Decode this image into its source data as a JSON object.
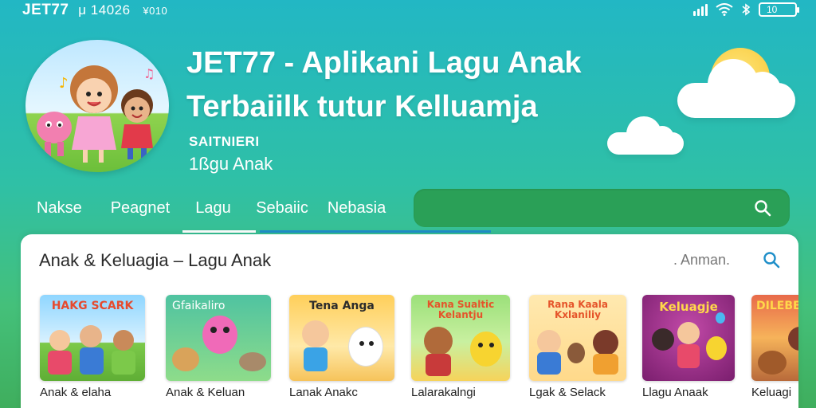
{
  "status_bar": {
    "carrier": "JET77",
    "time": "μ 14026",
    "extra": "¥010",
    "battery": "10"
  },
  "header": {
    "title_line1": "JET77 - Aplikani Lagu Anak",
    "title_line2": "Terbaiilk tutur Kelluamja",
    "subtitle": "SAITNIERI",
    "tagline": "1ßgu Anak"
  },
  "tabs": [
    {
      "label": "Nakse"
    },
    {
      "label": "Peagnet"
    },
    {
      "label": "Lagu"
    },
    {
      "label": "Sebaiic"
    },
    {
      "label": "Nebasia"
    }
  ],
  "search": {
    "placeholder": "",
    "icon": "search-icon"
  },
  "section": {
    "title": "Anak & Keluagia – Lagu Anak",
    "search_hint": ". Anman.",
    "search_icon": "search-icon"
  },
  "cards": [
    {
      "art_title": "HAKG SCARK",
      "caption": "Anak & elaha"
    },
    {
      "art_title": "Gfaikaliro",
      "caption": "Anak & Keluan"
    },
    {
      "art_title": "Tena Anga",
      "caption": "Lanak Anakc"
    },
    {
      "art_title": "Kana Sualtic Kelantju",
      "caption": "Lalarakalngi"
    },
    {
      "art_title": "Rana Kaala Kxlaniliy",
      "caption": "Lgak & Selack"
    },
    {
      "art_title": "Keluagje",
      "caption": "Llagu Anaak"
    },
    {
      "art_title": "DILEBE",
      "caption": "Keluagi"
    }
  ],
  "colors": {
    "accent_blue": "#1f8fc9",
    "search_bg": "#2aa057",
    "sun": "#f8c93a"
  }
}
